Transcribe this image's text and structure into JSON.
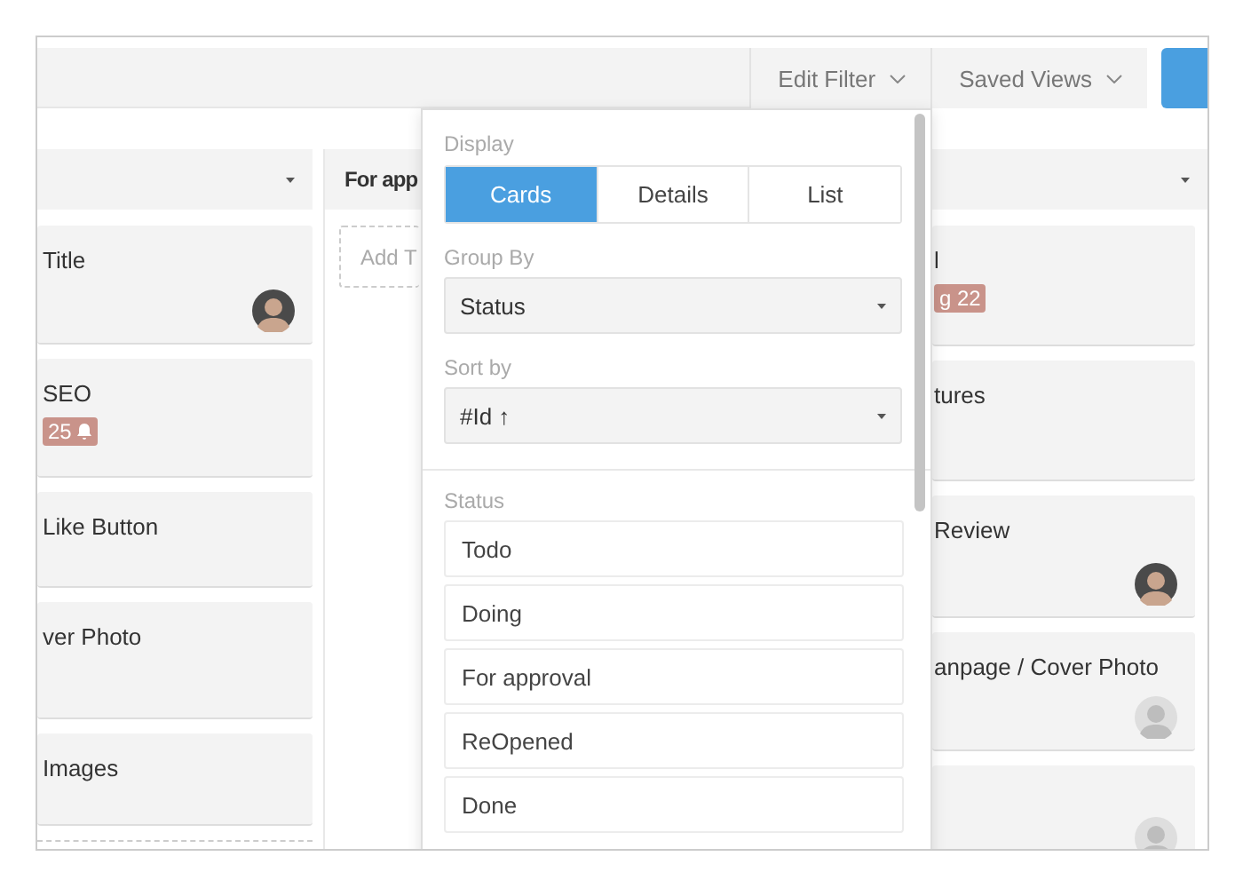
{
  "toolbar": {
    "buttons": [
      {
        "label": "Edit Filter"
      },
      {
        "label": "Saved Views"
      }
    ]
  },
  "board": {
    "columns": [
      {
        "cards": [
          {
            "title": "Title",
            "avatar": {
              "kind": "picture"
            }
          },
          {
            "title": "SEO",
            "badge": {
              "text": "25",
              "bell": true
            }
          },
          {
            "title": "Like Button"
          },
          {
            "title": "ver Photo"
          },
          {
            "title": "Images"
          }
        ]
      },
      {
        "title": "For app",
        "add_label": "Add T"
      },
      {
        "cards": [
          {
            "title": "l",
            "badge": {
              "text": "g 22",
              "bell": false
            }
          },
          {
            "title": "tures"
          },
          {
            "title": "Review",
            "avatar": {
              "kind": "picture"
            }
          },
          {
            "title": "anpage / Cover Photo",
            "avatar": {
              "kind": "picture"
            }
          },
          {
            "avatar": {
              "kind": "picture"
            }
          }
        ]
      }
    ]
  },
  "display_panel": {
    "display": {
      "label": "Display",
      "options": [
        {
          "label": "Cards",
          "selected": true
        },
        {
          "label": "Details",
          "selected": false
        },
        {
          "label": "List",
          "selected": false
        }
      ]
    },
    "group_by": {
      "label": "Group By",
      "value": "Status"
    },
    "sort_by": {
      "label": "Sort by",
      "value": "#Id ↑"
    },
    "status": {
      "label": "Status",
      "items": [
        "Todo",
        "Doing",
        "For approval",
        "ReOpened",
        "Done"
      ]
    }
  }
}
